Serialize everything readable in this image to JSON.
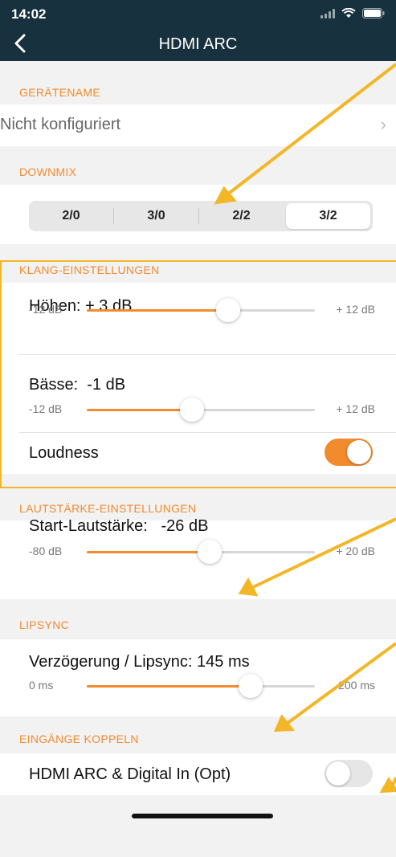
{
  "status": {
    "time": "14:02"
  },
  "header": {
    "title": "HDMI ARC"
  },
  "sections": {
    "geraetename": "GERÄTENAME",
    "downmix": "DOWNMIX",
    "klang": "KLANG-EINSTELLUNGEN",
    "lautstaerke": "LAUTSTÄRKE-EINSTELLUNGEN",
    "lipsync": "LIPSYNC",
    "eingaenge": "EINGÄNGE KOPPELN"
  },
  "device": {
    "name_value": "Nicht konfiguriert"
  },
  "downmix": {
    "options": [
      "2/0",
      "3/0",
      "2/2",
      "3/2"
    ],
    "selected": "3/2"
  },
  "hoehen": {
    "label": "Höhen:",
    "value": "+ 3 dB",
    "min": "-12 dB",
    "max": "+ 12 dB",
    "level": 0.62
  },
  "baesse": {
    "label": "Bässe:",
    "value": "-1 dB",
    "min": "-12 dB",
    "max": "+ 12 dB",
    "level": 0.46
  },
  "loudness": {
    "label": "Loudness",
    "state": "on"
  },
  "start_volume": {
    "label": "Start-Lautstärke:",
    "value": "-26 dB",
    "min": "-80 dB",
    "max": "+ 20 dB",
    "level": 0.54
  },
  "lipsync": {
    "label": "Verzögerung / Lipsync:",
    "value": "145 ms",
    "min": "0 ms",
    "max": "200 ms",
    "level": 0.72
  },
  "couple": {
    "label": "HDMI ARC & Digital In (Opt)",
    "state": "off"
  },
  "colors": {
    "accent": "#f28a2e",
    "header": "#17313e",
    "annotation": "#f2b627"
  }
}
